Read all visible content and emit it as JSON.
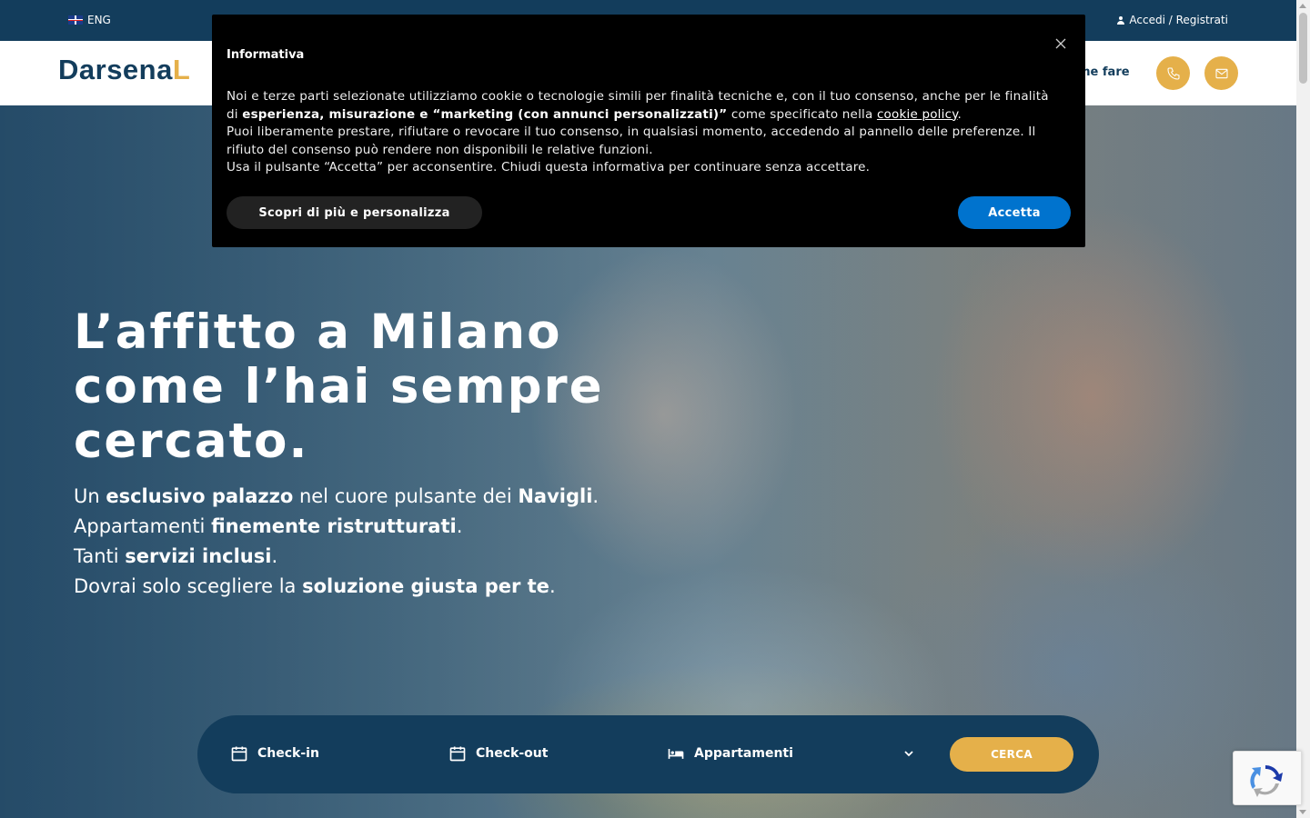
{
  "topbar": {
    "language": "ENG",
    "login_label": "Accedi / Registrati"
  },
  "header": {
    "logo_main": "Darsena",
    "logo_accent": "L",
    "nav_partial": "me fare"
  },
  "hero": {
    "title_lines": [
      "L’affitto a Milano",
      "come l’hai sempre",
      "cercato."
    ],
    "lines": [
      {
        "a": "Un ",
        "b": "esclusivo palazzo",
        "c": " nel cuore pulsante dei ",
        "d": "Navigli",
        "e": "."
      },
      {
        "a": "Appartamenti ",
        "b": "finemente ristrutturati",
        "c": ".",
        "d": "",
        "e": ""
      },
      {
        "a": "Tanti ",
        "b": "servizi inclusi",
        "c": ".",
        "d": "",
        "e": ""
      },
      {
        "a": "Dovrai solo scegliere la ",
        "b": "soluzione giusta per te",
        "c": ".",
        "d": "",
        "e": ""
      }
    ]
  },
  "search": {
    "checkin_label": "Check-in",
    "checkout_label": "Check-out",
    "type_label": "Appartamenti",
    "submit_label": "CERCA"
  },
  "cookie": {
    "title": "Informativa",
    "p1_a": "Noi e terze parti selezionate utilizziamo cookie o tecnologie simili per finalità tecniche e, con il tuo consenso, anche per le finalità di ",
    "p1_b": "esperienza, misurazione e “marketing (con annunci personalizzati)”",
    "p1_c": " come specificato nella ",
    "p1_link": "cookie policy",
    "p1_d": ".",
    "p2": "Puoi liberamente prestare, rifiutare o revocare il tuo consenso, in qualsiasi momento, accedendo al pannello delle preferenze. Il rifiuto del consenso può rendere non disponibili le relative funzioni.",
    "p3": "Usa il pulsante “Accetta” per acconsentire. Chiudi questa informativa per continuare senza accettare.",
    "more_label": "Scopri di più e personalizza",
    "accept_label": "Accetta"
  },
  "colors": {
    "navy": "#133d5c",
    "gold": "#e5b04a",
    "accept_blue": "#0073ce"
  }
}
